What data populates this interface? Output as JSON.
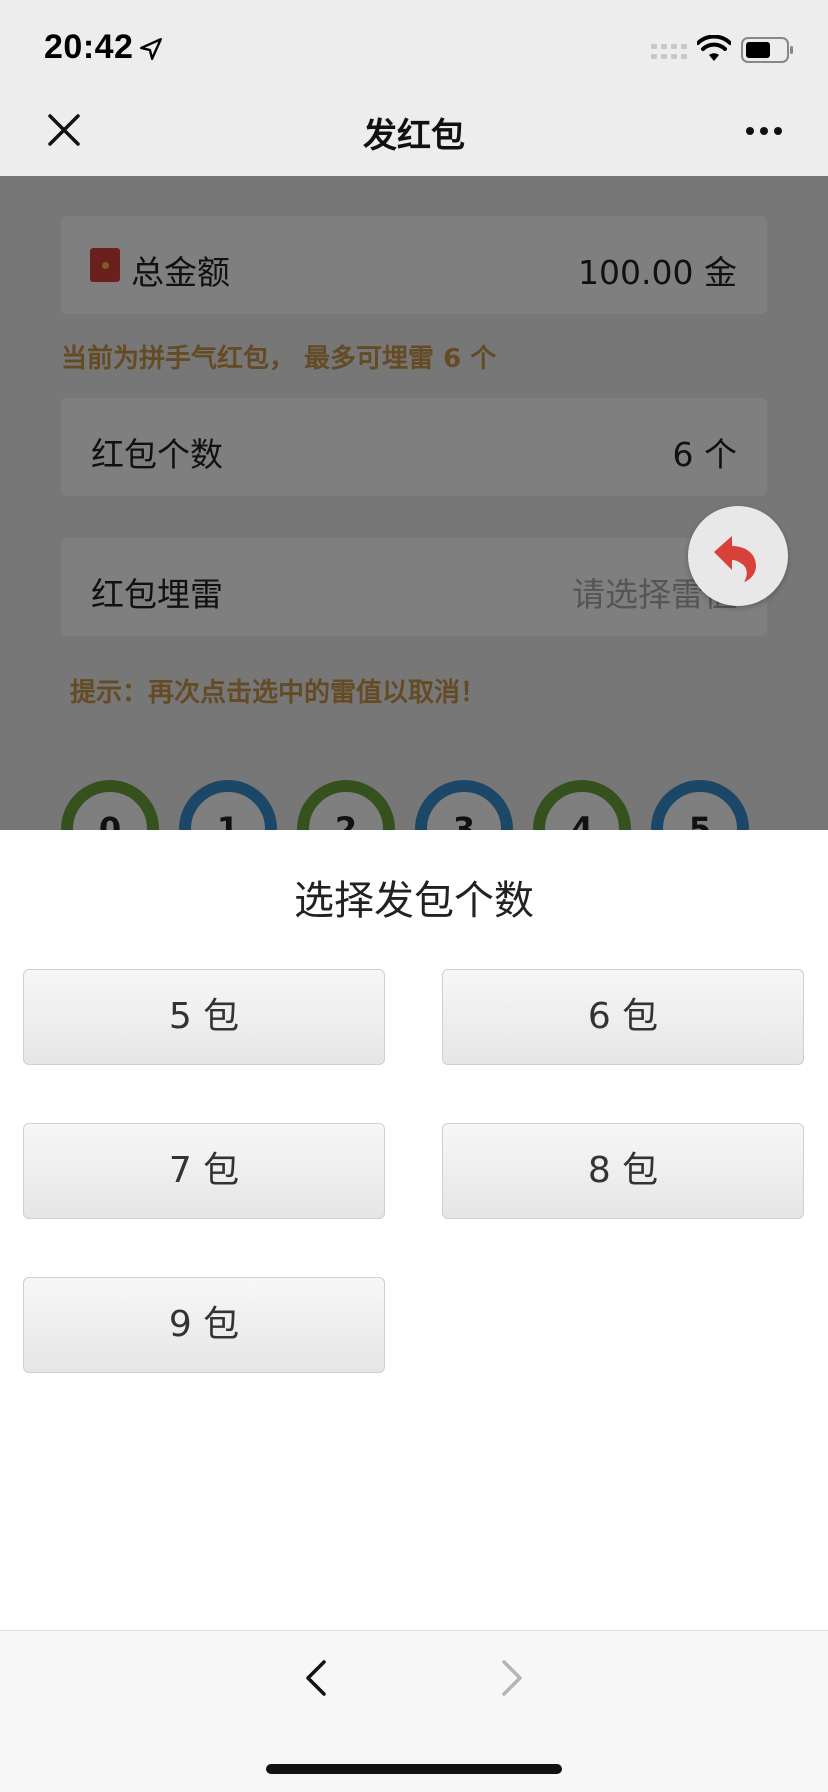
{
  "status_bar": {
    "time": "20:42",
    "icons": [
      "location-arrow-icon",
      "cellular-signal-icon",
      "wifi-icon",
      "battery-icon"
    ]
  },
  "nav": {
    "title": "发红包",
    "left_icon": "close-icon",
    "right_icon": "more-icon"
  },
  "form": {
    "total": {
      "label": "总金额",
      "value": "100.00  金"
    },
    "hint_mine_max": "当前为拼手气红包， 最多可埋雷 6 个",
    "count": {
      "label": "红包个数",
      "value": "6  个"
    },
    "mine": {
      "label": "红包埋雷",
      "placeholder": "请选择雷值"
    },
    "tip": "提示：再次点击选中的雷值以取消！",
    "chips": [
      "0",
      "1",
      "2",
      "3",
      "4",
      "5"
    ]
  },
  "sheet": {
    "title": "选择发包个数",
    "options": [
      "5 包",
      "6 包",
      "7 包",
      "8 包",
      "9 包"
    ]
  },
  "colors": {
    "gold_hint": "#c9964a",
    "chip_green": "#6aa33a",
    "chip_blue": "#3a8fcf",
    "undo_red": "#d8403a"
  }
}
